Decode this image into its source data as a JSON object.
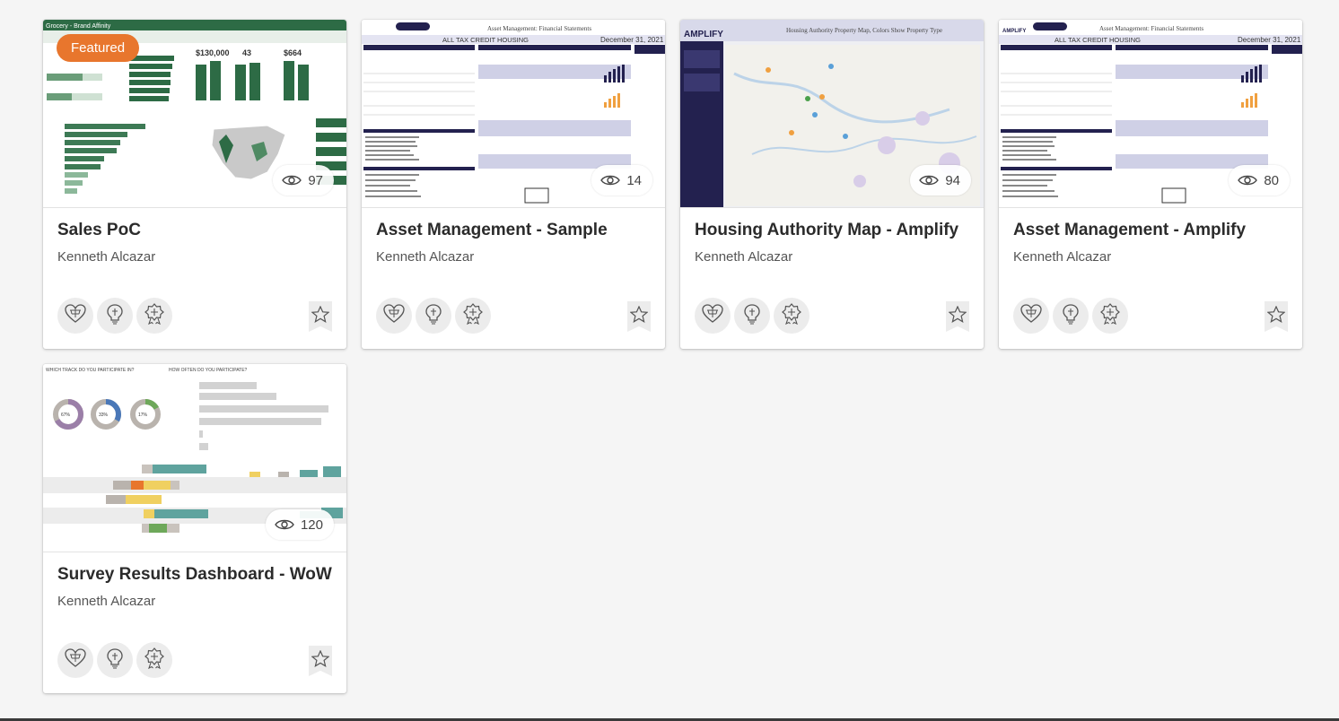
{
  "cards": [
    {
      "title": "Sales PoC",
      "author": "Kenneth Alcazar",
      "views": "97",
      "featured": "Featured",
      "thumb": "grocery"
    },
    {
      "title": "Asset Management - Sample",
      "author": "Kenneth Alcazar",
      "views": "14",
      "thumb": "asset"
    },
    {
      "title": "Housing Authority Map - Amplify",
      "author": "Kenneth Alcazar",
      "views": "94",
      "thumb": "map"
    },
    {
      "title": "Asset Management - Amplify",
      "author": "Kenneth Alcazar",
      "views": "80",
      "thumb": "asset2"
    },
    {
      "title": "Survey Results Dashboard - WoW",
      "author": "Kenneth Alcazar",
      "views": "120",
      "thumb": "survey"
    }
  ],
  "thumbnails": {
    "grocery": {
      "header": "Grocery - Brand Affinity",
      "kpis": [
        "$130,000",
        "43",
        "$664"
      ]
    },
    "asset": {
      "header": "Asset Management: Financial Statements",
      "subheader": "ALL TAX CREDIT HOUSING",
      "date": "December 31, 2021"
    },
    "map": {
      "logo": "AMPLIFY",
      "header": "Housing Authority Property Map, Colors Show Property Type"
    },
    "survey": {
      "q1": "WHICH TRACK DO YOU PARTICIPATE IN?",
      "q2": "HOW OFTEN DO YOU PARTICIPATE?",
      "donuts": [
        "67%",
        "33%",
        "17%"
      ]
    }
  },
  "icon_names": [
    "heart-network-icon",
    "lightbulb-icon",
    "award-icon",
    "star-icon",
    "eye-icon"
  ],
  "colors": {
    "featured": "#e8762d",
    "background": "#f5f5f5",
    "grocery_green": "#2d6b45",
    "asset_navy": "#23214f"
  }
}
